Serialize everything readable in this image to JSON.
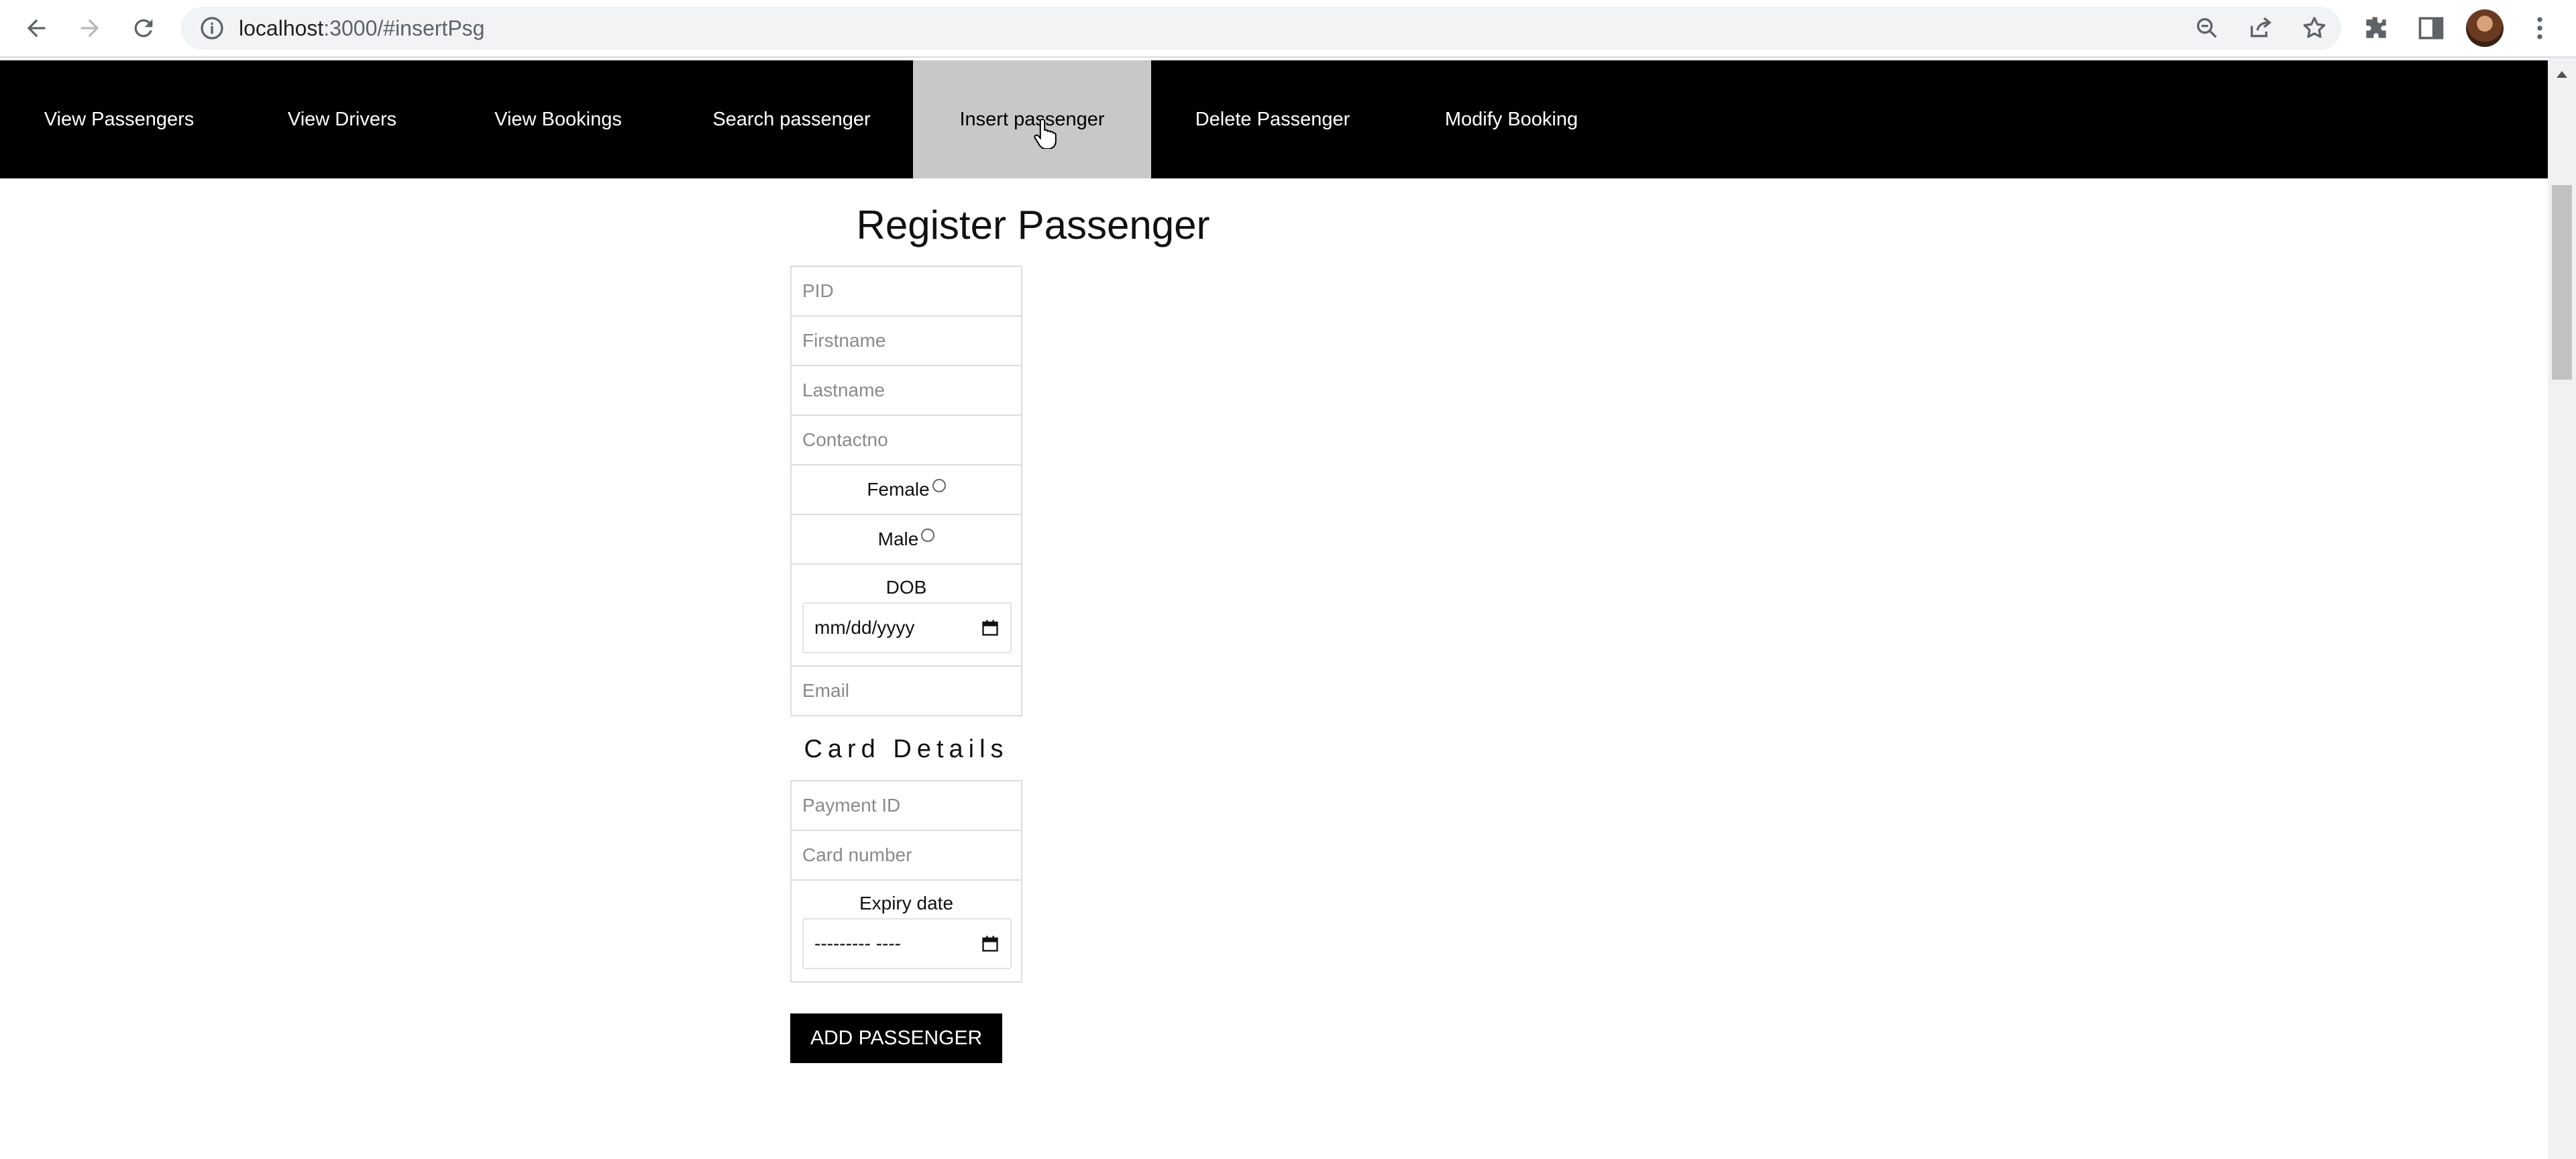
{
  "browser": {
    "url_host": "localhost",
    "url_path": ":3000/#insertPsg"
  },
  "nav": {
    "items": [
      {
        "label": "View Passengers"
      },
      {
        "label": "View Drivers"
      },
      {
        "label": "View Bookings"
      },
      {
        "label": "Search passenger"
      },
      {
        "label": "Insert passenger"
      },
      {
        "label": "Delete Passenger"
      },
      {
        "label": "Modify Booking"
      }
    ],
    "active": "Insert passenger"
  },
  "form": {
    "title": "Register Passenger",
    "pid_placeholder": "PID",
    "firstname_placeholder": "Firstname",
    "lastname_placeholder": "Lastname",
    "contact_placeholder": "Contactno",
    "female_label": "Female",
    "male_label": "Male",
    "dob_label": "DOB",
    "dob_value": "mm/dd/yyyy",
    "email_placeholder": "Email",
    "card_heading": "Card Details",
    "payment_id_placeholder": "Payment ID",
    "card_number_placeholder": "Card number",
    "expiry_label": "Expiry date",
    "expiry_value": "--------- ----",
    "submit_label": "ADD PASSENGER"
  },
  "icons": {
    "back": "back-arrow-icon",
    "forward": "forward-arrow-icon",
    "reload": "reload-icon",
    "site_info": "info-icon",
    "zoom": "zoom-icon",
    "share": "share-icon",
    "bookmark": "star-icon",
    "extensions": "puzzle-icon",
    "side_panel": "side-panel-icon",
    "menu": "kebab-menu-icon",
    "calendar": "calendar-icon"
  },
  "colors": {
    "nav_bg": "#000000",
    "nav_active_bg": "#c8c8c8",
    "button_bg": "#000000"
  }
}
